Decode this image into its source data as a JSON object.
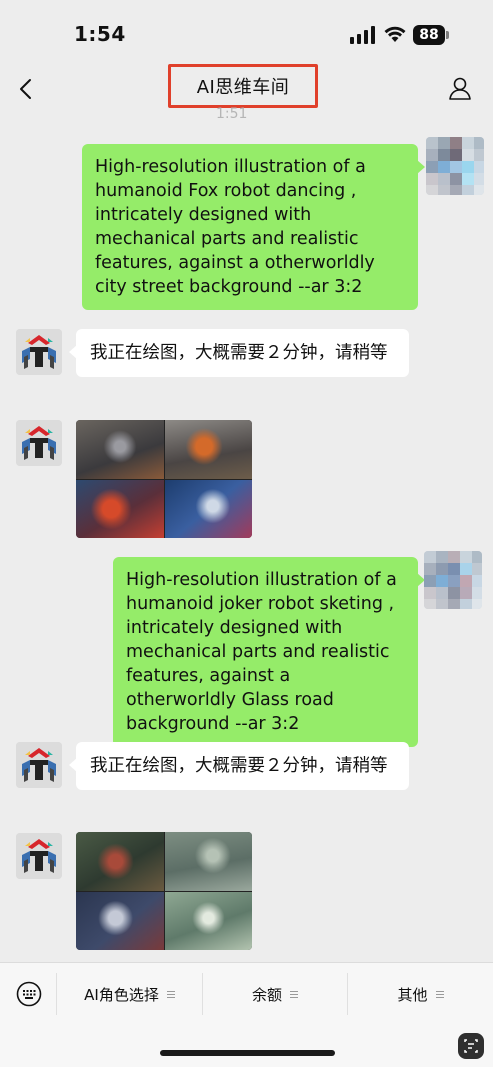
{
  "status": {
    "time": "1:54",
    "battery": "88"
  },
  "nav": {
    "title": "AI思维车间",
    "timestamp": "1:51"
  },
  "messages": [
    {
      "side": "out",
      "text": "High-resolution illustration of a humanoid Fox robot dancing , intricately designed with mechanical parts and realistic features, against a otherworldly city  street background --ar 3:2"
    },
    {
      "side": "in",
      "text": "我正在绘图，大概需要２分钟，请稍等"
    },
    {
      "side": "out",
      "text": "High-resolution illustration of a humanoid joker robot sketing , intricately designed with mechanical parts and realistic features, against a otherworldly Glass road background --ar 3:2"
    },
    {
      "side": "in",
      "text": "我正在绘图，大概需要２分钟，请稍等"
    }
  ],
  "bottom_menu": {
    "items": [
      {
        "label": "AI角色选择"
      },
      {
        "label": "余额"
      },
      {
        "label": "其他"
      }
    ]
  },
  "colors": {
    "accent_red": "#e0402b",
    "out_bubble": "#95ec69",
    "in_bubble": "#ffffff",
    "background": "#ededed"
  }
}
